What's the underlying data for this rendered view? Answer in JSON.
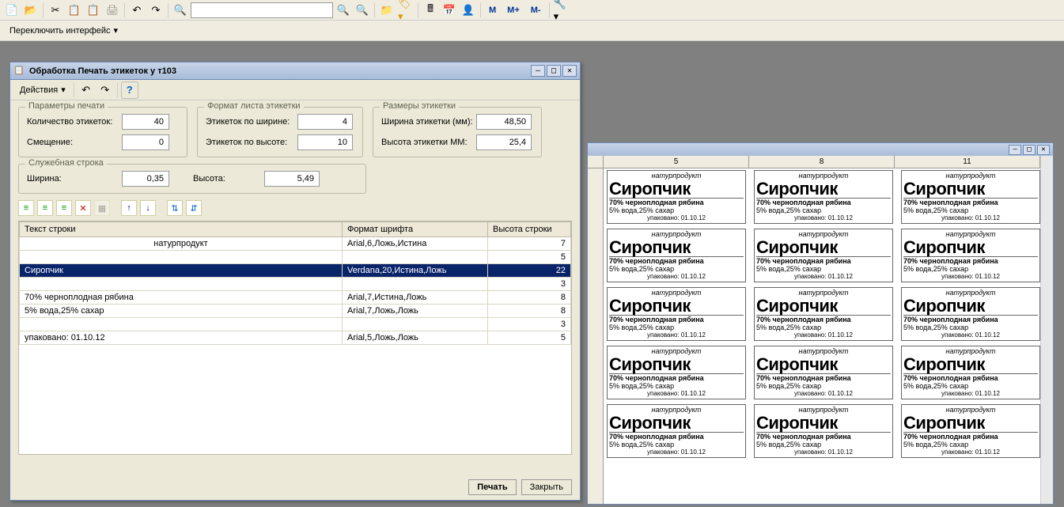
{
  "toolbar": {
    "m": "M",
    "m_plus": "M+",
    "m_minus": "M-"
  },
  "second_toolbar": {
    "switch_interface": "Переключить интерфейс"
  },
  "dialog": {
    "title": "Обработка  Печать этикеток у т103",
    "actions": "Действия",
    "params": {
      "legend": "Параметры печати",
      "qty_label": "Количество этикеток:",
      "qty_value": "40",
      "offset_label": "Смещение:",
      "offset_value": "0"
    },
    "sheet_format": {
      "legend": "Формат листа этикетки",
      "width_label": "Этикеток по ширине:",
      "width_value": "4",
      "height_label": "Этикеток по высоте:",
      "height_value": "10"
    },
    "label_size": {
      "legend": "Размеры этикетки",
      "width_label": "Ширина этикетки (мм):",
      "width_value": "48,50",
      "height_label": "Высота этикетки ММ:",
      "height_value": "25,4"
    },
    "service_row": {
      "legend": "Служебная строка",
      "width_label": "Ширина:",
      "width_value": "0,35",
      "height_label": "Высота:",
      "height_value": "5,49"
    },
    "grid": {
      "col_text": "Текст строки",
      "col_font": "Формат шрифта",
      "col_height": "Высота строки",
      "rows": [
        {
          "text": "натурпродукт",
          "font": "Arial,6,Ложь,Истина",
          "h": "7",
          "center": true
        },
        {
          "text": "",
          "font": "",
          "h": "5"
        },
        {
          "text": "Сиропчик",
          "font": "Verdana,20,Истина,Ложь",
          "h": "22",
          "selected": true
        },
        {
          "text": "",
          "font": "",
          "h": "3"
        },
        {
          "text": "70% черноплодная рябина",
          "font": "Arial,7,Истина,Ложь",
          "h": "8"
        },
        {
          "text": "5% вода,25% сахар",
          "font": "Arial,7,Ложь,Ложь",
          "h": "8"
        },
        {
          "text": "",
          "font": "",
          "h": "3"
        },
        {
          "text": "   упаковано: 01.10.12",
          "font": "Arial,5,Ложь,Ложь",
          "h": "5"
        }
      ]
    },
    "btn_print": "Печать",
    "btn_close": "Закрыть"
  },
  "preview": {
    "ruler_marks": [
      "5",
      "8",
      "11"
    ],
    "label": {
      "natur": "натурпродукт",
      "title": "Сиропчик",
      "line1": "70% черноплодная рябина",
      "line2": "5% вода,25% сахар",
      "pack": "упаковано: 01.10.12"
    }
  }
}
